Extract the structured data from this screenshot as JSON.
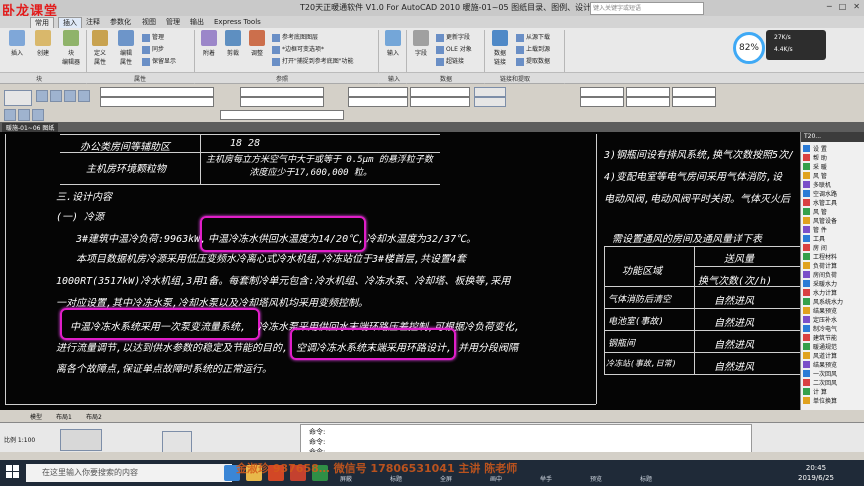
{
  "app": {
    "brand": "卧龙课堂",
    "title": "T20天正暖通软件 V1.0 For AutoCAD 2010     暖施-01~05  图纸目录、图例、设计说明_t3.dwg",
    "search_placeholder": "键入关键字或短语"
  },
  "menu_tabs": [
    {
      "label": "常用"
    },
    {
      "label": "插入"
    },
    {
      "label": "注释"
    },
    {
      "label": "参数化"
    },
    {
      "label": "视图"
    },
    {
      "label": "管理"
    },
    {
      "label": "输出"
    },
    {
      "label": "Express Tools"
    }
  ],
  "ribbon": {
    "big_buttons": [
      {
        "label": "插入"
      },
      {
        "label": "创建"
      },
      {
        "label": "块\n编辑器"
      },
      {
        "label": "定义\n属性"
      },
      {
        "label": "编辑\n属性"
      },
      {
        "label": "附着"
      },
      {
        "label": "剪裁"
      },
      {
        "label": "调整"
      },
      {
        "label": "输入"
      },
      {
        "label": "字段"
      },
      {
        "label": "数据\n链接"
      }
    ],
    "small_items": {
      "attr": [
        "管理",
        "同步",
        "保留显示"
      ],
      "ref": [
        "参考底图图层",
        "*边框可变选项*",
        "打开\"捕捉到参考底图\"功能"
      ],
      "import": [
        "更新字段",
        "OLE 对象",
        "超链接"
      ],
      "link": [
        "从源下载",
        "上载到源",
        "提取数据"
      ]
    },
    "panel_names": [
      "块",
      "属性",
      "参照",
      "输入",
      "数据",
      "链接和提取"
    ]
  },
  "cpu_widget": {
    "value": "82%",
    "up": "27K/s",
    "down": "4.4K/s"
  },
  "doc_tab": "暖施-01~06 图纸",
  "drawing": {
    "rows_top": [
      {
        "c1": "办公类房间等辅助区",
        "c2": "18  28"
      },
      {
        "c1": "主机房环境颗粒物",
        "c2": "主机房每立方米空气中大于或等于 0.5μm 的悬浮粒子数\n        浓度应少于17,600,000 粒。"
      }
    ],
    "section_title": "三.设计内容",
    "subsection": "(一) 冷源",
    "para1_prefix": "3#建筑中温冷负荷:9963kW,",
    "para1_highlight": "中温冷冻水供回水温度为14/20℃,",
    "para1_suffix": "冷却水温度为32/37℃。",
    "para2a": "本项目数据机房冷源采用低压变频水冷离心式冷水机组,冷冻站位于3#楼首层,共设置4套",
    "para2b": "1000RT(3517kW)冷水机组,3用1备。每套制冷单元包含:冷水机组、冷冻水泵、冷却塔、板换等,采用",
    "para2c": "一对应设置,其中冷冻水泵,冷却水泵以及冷却塔风机均采用变频控制。",
    "para3_highlight1": "中温冷冻水系统采用一次泵变流量系统,",
    "para3_a": "冷冻水泵采用供回水末端环路压差控制,可根据冷负荷变化,",
    "para3_b": "进行流量调节,以达到供水参数的稳定及节能的目的,",
    "para3_highlight2": "空调冷冻水系统末端采用环路设计,",
    "para3_c": "并用分段阀隔",
    "para3_d": "离各个故障点,保证单点故障时系统的正常运行。",
    "right_top1": "3)钢瓶间设有排风系统,换气次数按照5次/",
    "right_top2": "4)变配电室等电气房间采用气体消防,设",
    "right_top3": "电动风阀,电动风阀平时关闭。气体灭火后",
    "table_title": "需设置通风的房间及通风量详下表",
    "table_head_area": "功能区域",
    "table_head_vol": "送风量",
    "table_head_sub": "换气次数(次/h)",
    "table_rows": [
      {
        "area": "气体消防后清空",
        "vol": "自然进风"
      },
      {
        "area": "电池室(事故)",
        "vol": "自然进风"
      },
      {
        "area": "钢瓶间",
        "vol": "自然进风"
      },
      {
        "area": "冷冻站(事故,日常)",
        "vol": "自然进风"
      }
    ]
  },
  "right_panel": {
    "header": "T20...",
    "items": [
      "设  置",
      "帮  助",
      "采  暖",
      "风  管",
      "多联机",
      "空调水路",
      "水管工具",
      "风  管",
      "风管设备",
      "管  件",
      "工具",
      "房  间",
      "工程材料",
      "负荷计算",
      "房间负荷",
      "采暖水力",
      "水力计算",
      "风系统水力",
      "结果预览",
      "定压补水",
      "制冷电气",
      "建筑节能",
      "暖通规范",
      "风道计算",
      "结果预览",
      "一次回风",
      "二次回风",
      "计  算",
      "单位换算"
    ]
  },
  "layout_tabs": [
    "模型",
    "布局1",
    "布局2"
  ],
  "command_lines": [
    "命令:",
    "命令:",
    "命令:"
  ],
  "status": {
    "scale": "比例 1:100"
  },
  "taskbar": {
    "search_placeholder": "在这里输入你要搜索的内容",
    "time": "20:45",
    "date": "2019/6/25",
    "watermark": "金淑珍  937658…      微信号 17806531041        主讲  陈老师",
    "player_controls": [
      "高帧",
      "屏蔽",
      "标题",
      "全屏",
      "画中",
      "举手",
      "预览",
      "标题"
    ]
  },
  "colors": {
    "highlight": "#e01ec8",
    "canvas": "#050505",
    "ribbon": "#e9e9e9"
  }
}
